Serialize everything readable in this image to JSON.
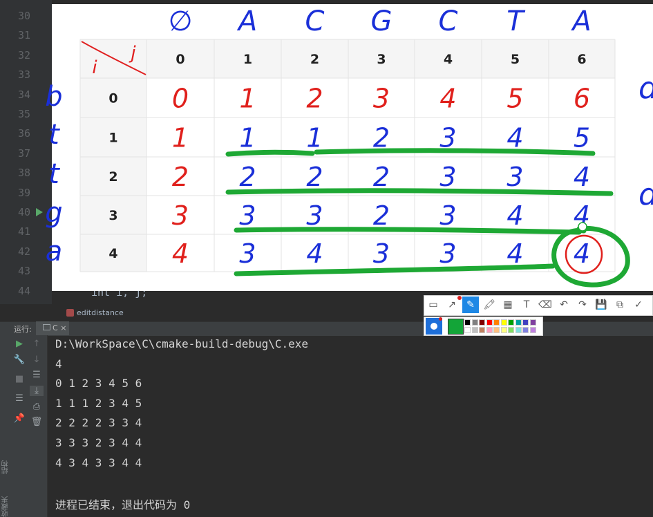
{
  "editor": {
    "line_numbers": [
      "30",
      "31",
      "32",
      "33",
      "34",
      "35",
      "36",
      "37",
      "38",
      "39",
      "40",
      "41",
      "42",
      "43",
      "44"
    ],
    "code_peek": "int i, j;",
    "breadcrumb": "editdistance"
  },
  "annotation": {
    "top_letters": [
      "∅",
      "A",
      "C",
      "G",
      "C",
      "T",
      "A"
    ],
    "side_letters": [
      "b",
      "t",
      "t",
      "g",
      "a"
    ],
    "right_letters": [
      "d",
      "d"
    ],
    "corner_i": "i",
    "corner_j": "j",
    "col_headers": [
      "0",
      "1",
      "2",
      "3",
      "4",
      "5",
      "6"
    ],
    "row_headers": [
      "0",
      "1",
      "2",
      "3",
      "4"
    ],
    "matrix": [
      [
        "0",
        "1",
        "2",
        "3",
        "4",
        "5",
        "6"
      ],
      [
        "1",
        "1",
        "1",
        "2",
        "3",
        "4",
        "5"
      ],
      [
        "2",
        "2",
        "2",
        "2",
        "3",
        "3",
        "4"
      ],
      [
        "3",
        "3",
        "3",
        "2",
        "3",
        "4",
        "4"
      ],
      [
        "4",
        "3",
        "4",
        "3",
        "3",
        "4",
        "4"
      ]
    ],
    "colors": {
      "red": "#e0201c",
      "blue": "#1a2fd8",
      "green": "#1ea834"
    }
  },
  "run_panel": {
    "label": "运行:",
    "tab": "C",
    "tab_close": "×",
    "side_label_structure": "结构",
    "side_label_favorites": "收藏夹",
    "lines": [
      "D:\\WorkSpace\\C\\cmake-build-debug\\C.exe",
      "4",
      "0 1 2 3 4 5 6",
      "1 1 1 2 3 4 5",
      "2 2 2 2 3 3 4",
      "3 3 3 2 3 4 4",
      "4 3 4 3 3 4 4",
      "",
      "进程已结束，退出代码为 0"
    ]
  },
  "annotation_toolbar": {
    "tools": [
      {
        "name": "rect-tool-icon",
        "glyph": "▭"
      },
      {
        "name": "line-tool-icon",
        "glyph": "↗"
      },
      {
        "name": "pen-tool-icon",
        "glyph": "✎"
      },
      {
        "name": "marker-tool-icon",
        "glyph": "🖍"
      },
      {
        "name": "mosaic-tool-icon",
        "glyph": "▦"
      },
      {
        "name": "text-tool-icon",
        "glyph": "T"
      },
      {
        "name": "eraser-tool-icon",
        "glyph": "⌫"
      },
      {
        "name": "undo-icon",
        "glyph": "↶"
      },
      {
        "name": "redo-icon",
        "glyph": "↷"
      },
      {
        "name": "save-icon",
        "glyph": "💾"
      },
      {
        "name": "copy-icon",
        "glyph": "⧉"
      },
      {
        "name": "confirm-icon",
        "glyph": "✓"
      }
    ],
    "current_color": "#13a538",
    "palette_top": [
      "#000000",
      "#808080",
      "#800000",
      "#ff0000",
      "#ff8000",
      "#ffff00",
      "#00a000",
      "#00a0a0",
      "#4040c0",
      "#8040a0"
    ],
    "palette_bottom": [
      "#ffffff",
      "#c0c0c0",
      "#c08060",
      "#ffa0c0",
      "#ffc080",
      "#ffff80",
      "#80e060",
      "#80e0e0",
      "#8080e0",
      "#c080e0"
    ]
  }
}
